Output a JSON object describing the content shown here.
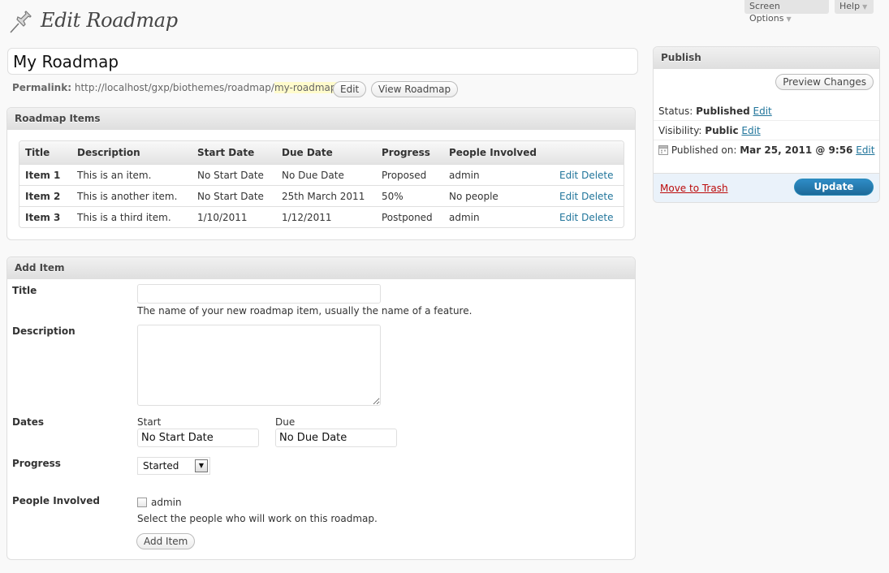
{
  "screen_meta": {
    "screen_options": "Screen Options",
    "help": "Help"
  },
  "page": {
    "title": "Edit Roadmap",
    "post_title": "My Roadmap"
  },
  "permalink": {
    "label": "Permalink:",
    "base_url": "http://localhost/gxp/biothemes/roadmap/",
    "slug": "my-roadmap",
    "trailing": "/",
    "edit_button": "Edit",
    "view_button": "View Roadmap"
  },
  "roadmap_items": {
    "heading": "Roadmap Items",
    "columns": [
      "Title",
      "Description",
      "Start Date",
      "Due Date",
      "Progress",
      "People Involved"
    ],
    "rows": [
      {
        "title": "Item 1",
        "description": "This is an item.",
        "start": "No Start Date",
        "due": "No Due Date",
        "progress": "Proposed",
        "people": "admin",
        "edit": "Edit",
        "delete": "Delete"
      },
      {
        "title": "Item 2",
        "description": "This is another item.",
        "start": "No Start Date",
        "due": "25th March 2011",
        "progress": "50%",
        "people": "No people",
        "edit": "Edit",
        "delete": "Delete"
      },
      {
        "title": "Item 3",
        "description": "This is a third item.",
        "start": "1/10/2011",
        "due": "1/12/2011",
        "progress": "Postponed",
        "people": "admin",
        "edit": "Edit",
        "delete": "Delete"
      }
    ]
  },
  "add_item": {
    "heading": "Add Item",
    "title_label": "Title",
    "title_value": "",
    "title_help": "The name of your new roadmap item, usually the name of a feature.",
    "description_label": "Description",
    "description_value": "",
    "dates_label": "Dates",
    "start_label": "Start",
    "start_value": "No Start Date",
    "due_label": "Due",
    "due_value": "No Due Date",
    "progress_label": "Progress",
    "progress_value": "Started",
    "people_label": "People Involved",
    "people_option": "admin",
    "people_help": "Select the people who will work on this roadmap.",
    "submit": "Add Item"
  },
  "publish": {
    "heading": "Publish",
    "preview_button": "Preview Changes",
    "status_label": "Status:",
    "status_value": "Published",
    "visibility_label": "Visibility:",
    "visibility_value": "Public",
    "published_label": "Published on:",
    "published_value": "Mar 25, 2011 @ 9:56",
    "edit_link": "Edit",
    "trash": "Move to Trash",
    "update": "Update"
  }
}
